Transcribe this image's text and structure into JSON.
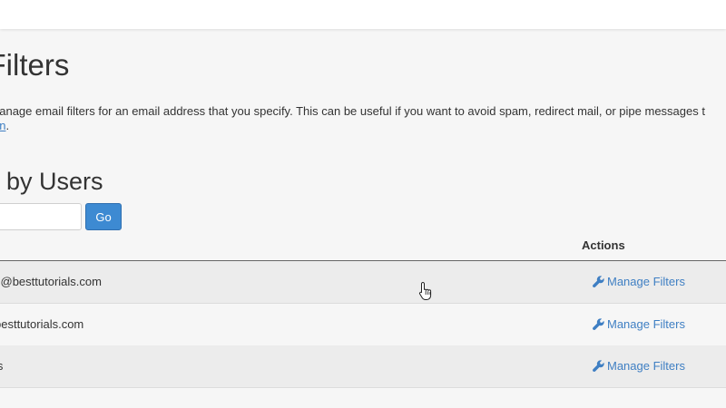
{
  "page": {
    "title": "l Filters",
    "description_line1": "nanage email filters for an email address that you specify. This can be useful if you want to avoid spam, redirect mail, or pipe messages t",
    "description_link": "on",
    "description_end": "."
  },
  "section": {
    "title": "s by Users"
  },
  "search": {
    "value": "",
    "placeholder": "",
    "go_label": "Go"
  },
  "table": {
    "columns": [
      "Actions"
    ],
    "rows": [
      {
        "email": "s@besttutorials.com",
        "action": "Manage Filters"
      },
      {
        "email": "besttutorials.com",
        "action": "Manage Filters"
      },
      {
        "email": "ls",
        "action": "Manage Filters"
      }
    ]
  },
  "colors": {
    "link": "#3f7fc3",
    "button": "#3d8ad2"
  }
}
